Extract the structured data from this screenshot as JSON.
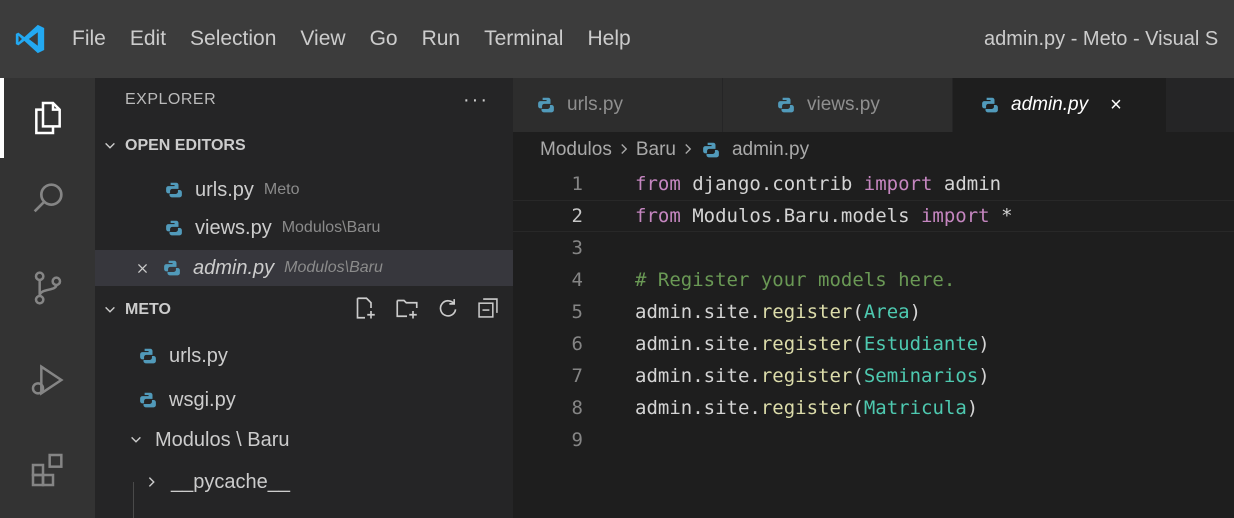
{
  "window": {
    "title": "admin.py - Meto - Visual S"
  },
  "menu": [
    "File",
    "Edit",
    "Selection",
    "View",
    "Go",
    "Run",
    "Terminal",
    "Help"
  ],
  "activity_bar": {
    "icons": [
      "explorer-icon",
      "search-icon",
      "source-control-icon",
      "run-debug-icon",
      "extensions-icon"
    ],
    "active": "explorer-icon"
  },
  "sidebar": {
    "title": "EXPLORER",
    "more": "···",
    "open_editors": {
      "label": "OPEN EDITORS",
      "items": [
        {
          "name": "urls.py",
          "desc": "Meto"
        },
        {
          "name": "views.py",
          "desc": "Modulos\\Baru"
        },
        {
          "name": "admin.py",
          "desc": "Modulos\\Baru"
        }
      ]
    },
    "project": {
      "label": "METO",
      "items": [
        {
          "name": "urls.py"
        },
        {
          "name": "wsgi.py"
        },
        {
          "name": "Modulos \\ Baru"
        },
        {
          "name": "__pycache__"
        }
      ]
    }
  },
  "tabs": [
    {
      "label": "urls.py"
    },
    {
      "label": "views.py"
    },
    {
      "label": "admin.py",
      "close": "×"
    }
  ],
  "breadcrumb": [
    "Modulos",
    "Baru",
    "admin.py"
  ],
  "code": {
    "line_numbers": [
      "1",
      "2",
      "3",
      "4",
      "5",
      "6",
      "7",
      "8",
      "9"
    ],
    "line1": {
      "k1": "from",
      "mod": " django.contrib ",
      "k2": "import",
      "rest": " admin"
    },
    "line2": {
      "k1": "from",
      "mod": " Modulos.Baru.models ",
      "k2": "import",
      "rest": " *"
    },
    "line4": {
      "comment": "# Register your models here."
    },
    "registers": [
      {
        "call": "admin.site.",
        "fn": "register",
        "open": "(",
        "arg": "Area",
        "close": ")"
      },
      {
        "call": "admin.site.",
        "fn": "register",
        "open": "(",
        "arg": "Estudiante",
        "close": ")"
      },
      {
        "call": "admin.site.",
        "fn": "register",
        "open": "(",
        "arg": "Seminarios",
        "close": ")"
      },
      {
        "call": "admin.site.",
        "fn": "register",
        "open": "(",
        "arg": "Matricula",
        "close": ")"
      }
    ]
  },
  "colors": {
    "python_icon": "#519aba",
    "keyword": "#c586c0",
    "class": "#4ec9b0",
    "comment": "#6a9955",
    "function": "#dcdcaa",
    "vscode_blue": "#23a9f2"
  }
}
